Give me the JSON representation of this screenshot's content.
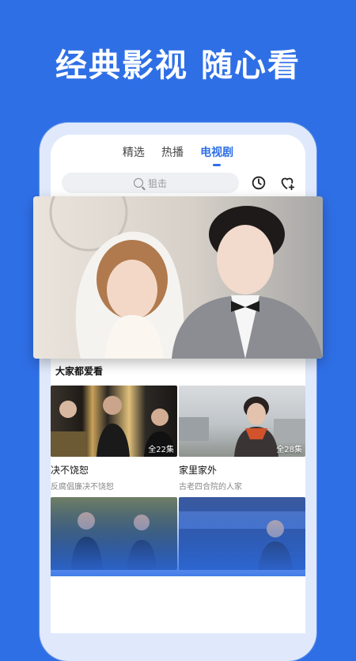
{
  "headline": "经典影视 随心看",
  "tabs": [
    {
      "label": "精选",
      "active": false
    },
    {
      "label": "热播",
      "active": false
    },
    {
      "label": "电视剧",
      "active": true
    }
  ],
  "search": {
    "placeholder": "狙击",
    "icon": "search-icon"
  },
  "header_icons": {
    "history": "history-clock-icon",
    "favorites": "heart-add-icon"
  },
  "section": {
    "title": "大家都爱看"
  },
  "cards": [
    {
      "title": "决不饶恕",
      "subtitle": "反腐倡廉决不饶恕",
      "episodes": "全22集"
    },
    {
      "title": "家里家外",
      "subtitle": "古老四合院的人家",
      "episodes": "全28集"
    }
  ],
  "colors": {
    "brand": "#2f6fe6",
    "active_tab": "#2f6fe6",
    "background": "#2f6fe6"
  }
}
